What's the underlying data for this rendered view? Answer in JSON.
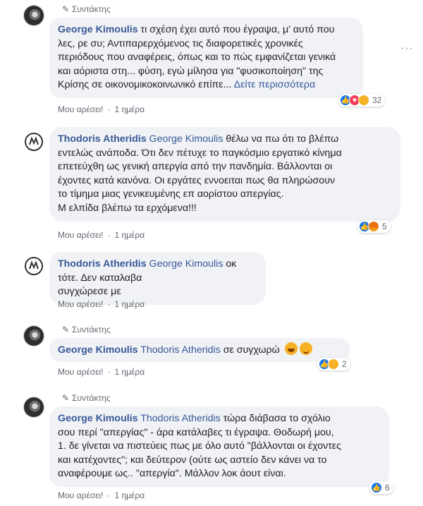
{
  "colors": {
    "link": "#385898",
    "bubble": "#f0f2f5",
    "meta": "#606770",
    "like": "#1877f2"
  },
  "comments": [
    {
      "badge": "Συντάκτης",
      "author": "George Kimoulis",
      "lines": [
        "τι σχέση έχει αυτό που έγραψα, μ' αυτό που",
        "λες, ρε συ; Αντιπαρερχόμενος τις διαφορετικές χρονικές",
        "περιόδους που αναφέρεις, όπως και το πώς εμφανίζεται γενικά",
        "και αόριστα στη... φύση, εγώ μίλησα για \"φυσικοποίηση\" της",
        "Κρίσης σε οικονομικοκοινωνικό επίπε... "
      ],
      "see_more": "Δείτε περισσότερα",
      "reactions": [
        "like-icon",
        "love-icon",
        "sad-icon"
      ],
      "reaction_count": "32",
      "like_label": "Μου αρέσει!",
      "time": "1 ημέρα"
    },
    {
      "author": "Thodoris Atheridis",
      "mention": "George Kimoulis",
      "lines": [
        "θέλω να πω ότι το βλέπω",
        "εντελώς ανάποδα. Ότι δεν πέτυχε το παγκόσμιο εργατικό κίνημα",
        "επετεύχθη ως γενική απεργία από την πανδημία. Βάλλονται οι",
        "έχοντες κατά κανόνα. Οι εργάτες εννοειται πως θα πληρώσουν",
        "το τίμημα μιας γενικευμένης επ αορίστου απεργίας.",
        "Μ ελπίδα βλέπω τα ερχόμενα!!!"
      ],
      "reactions": [
        "like-icon",
        "angry-icon"
      ],
      "reaction_count": "5",
      "like_label": "Μου αρέσει!",
      "time": "1 ημέρα"
    },
    {
      "author": "Thodoris Atheridis",
      "mention": "George Kimoulis",
      "lines": [
        "οκ τότε. Δεν καταλαβα",
        "συγχώρεσε με"
      ],
      "like_label": "Μου αρέσει!",
      "time": "1 ημέρα"
    },
    {
      "badge": "Συντάκτης",
      "author": "George Kimoulis",
      "mention": "Thodoris Atheridis",
      "lines": [
        "σε συγχωρώ"
      ],
      "reactions": [
        "like-icon",
        "haha-icon"
      ],
      "reaction_count": "2",
      "like_label": "Μου αρέσει!",
      "time": "1 ημέρα"
    },
    {
      "badge": "Συντάκτης",
      "author": "George Kimoulis",
      "mention": "Thodoris Atheridis",
      "lines": [
        "τώρα διάβασα το σχόλιο",
        "σου περί \"απεργίας\" - άρα κατάλαβες τι έγραψα. Θοδωρή μου,",
        "1. δε γίνεται να πιστεύεις πως με όλο αυτό \"βάλλονται οι έχοντες",
        "και κατέχοντες\"; και δεύτερον (ούτε ως αστείο δεν κάνει να το",
        "αναφέρουμε ως.. \"απεργία\". Μάλλον λοκ άουτ είναι."
      ],
      "reactions": [
        "like-icon"
      ],
      "reaction_count": "6",
      "like_label": "Μου αρέσει!",
      "time": "1 ημέρα"
    }
  ]
}
